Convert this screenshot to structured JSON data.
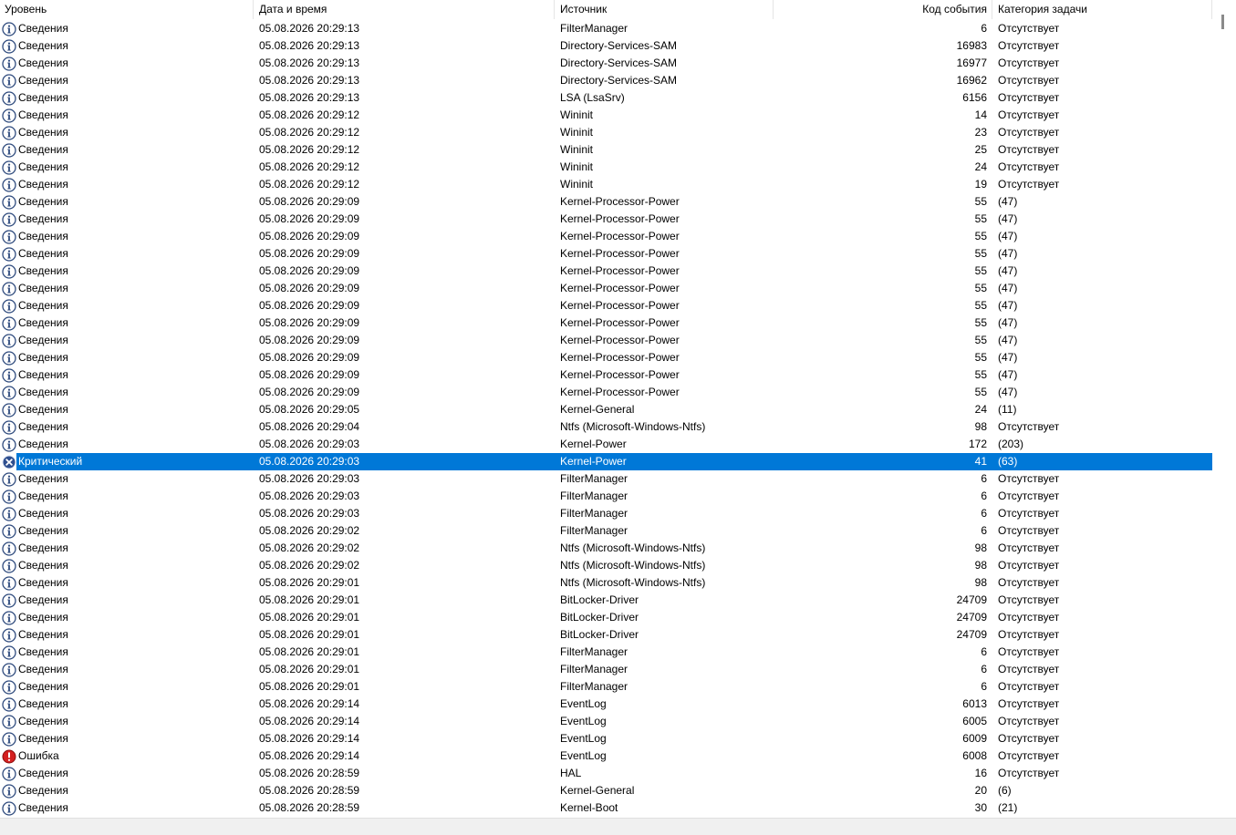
{
  "columns": {
    "level": "Уровень",
    "datetime": "Дата и время",
    "source": "Источник",
    "event_id": "Код события",
    "task_category": "Категория задачи"
  },
  "selected_row": 25,
  "rows": [
    {
      "level": "Сведения",
      "type": "info",
      "datetime": "05.08.2026 20:29:13",
      "source": "FilterManager",
      "event_id": "6",
      "category": "Отсутствует"
    },
    {
      "level": "Сведения",
      "type": "info",
      "datetime": "05.08.2026 20:29:13",
      "source": "Directory-Services-SAM",
      "event_id": "16983",
      "category": "Отсутствует"
    },
    {
      "level": "Сведения",
      "type": "info",
      "datetime": "05.08.2026 20:29:13",
      "source": "Directory-Services-SAM",
      "event_id": "16977",
      "category": "Отсутствует"
    },
    {
      "level": "Сведения",
      "type": "info",
      "datetime": "05.08.2026 20:29:13",
      "source": "Directory-Services-SAM",
      "event_id": "16962",
      "category": "Отсутствует"
    },
    {
      "level": "Сведения",
      "type": "info",
      "datetime": "05.08.2026 20:29:13",
      "source": "LSA (LsaSrv)",
      "event_id": "6156",
      "category": "Отсутствует"
    },
    {
      "level": "Сведения",
      "type": "info",
      "datetime": "05.08.2026 20:29:12",
      "source": "Wininit",
      "event_id": "14",
      "category": "Отсутствует"
    },
    {
      "level": "Сведения",
      "type": "info",
      "datetime": "05.08.2026 20:29:12",
      "source": "Wininit",
      "event_id": "23",
      "category": "Отсутствует"
    },
    {
      "level": "Сведения",
      "type": "info",
      "datetime": "05.08.2026 20:29:12",
      "source": "Wininit",
      "event_id": "25",
      "category": "Отсутствует"
    },
    {
      "level": "Сведения",
      "type": "info",
      "datetime": "05.08.2026 20:29:12",
      "source": "Wininit",
      "event_id": "24",
      "category": "Отсутствует"
    },
    {
      "level": "Сведения",
      "type": "info",
      "datetime": "05.08.2026 20:29:12",
      "source": "Wininit",
      "event_id": "19",
      "category": "Отсутствует"
    },
    {
      "level": "Сведения",
      "type": "info",
      "datetime": "05.08.2026 20:29:09",
      "source": "Kernel-Processor-Power",
      "event_id": "55",
      "category": "(47)"
    },
    {
      "level": "Сведения",
      "type": "info",
      "datetime": "05.08.2026 20:29:09",
      "source": "Kernel-Processor-Power",
      "event_id": "55",
      "category": "(47)"
    },
    {
      "level": "Сведения",
      "type": "info",
      "datetime": "05.08.2026 20:29:09",
      "source": "Kernel-Processor-Power",
      "event_id": "55",
      "category": "(47)"
    },
    {
      "level": "Сведения",
      "type": "info",
      "datetime": "05.08.2026 20:29:09",
      "source": "Kernel-Processor-Power",
      "event_id": "55",
      "category": "(47)"
    },
    {
      "level": "Сведения",
      "type": "info",
      "datetime": "05.08.2026 20:29:09",
      "source": "Kernel-Processor-Power",
      "event_id": "55",
      "category": "(47)"
    },
    {
      "level": "Сведения",
      "type": "info",
      "datetime": "05.08.2026 20:29:09",
      "source": "Kernel-Processor-Power",
      "event_id": "55",
      "category": "(47)"
    },
    {
      "level": "Сведения",
      "type": "info",
      "datetime": "05.08.2026 20:29:09",
      "source": "Kernel-Processor-Power",
      "event_id": "55",
      "category": "(47)"
    },
    {
      "level": "Сведения",
      "type": "info",
      "datetime": "05.08.2026 20:29:09",
      "source": "Kernel-Processor-Power",
      "event_id": "55",
      "category": "(47)"
    },
    {
      "level": "Сведения",
      "type": "info",
      "datetime": "05.08.2026 20:29:09",
      "source": "Kernel-Processor-Power",
      "event_id": "55",
      "category": "(47)"
    },
    {
      "level": "Сведения",
      "type": "info",
      "datetime": "05.08.2026 20:29:09",
      "source": "Kernel-Processor-Power",
      "event_id": "55",
      "category": "(47)"
    },
    {
      "level": "Сведения",
      "type": "info",
      "datetime": "05.08.2026 20:29:09",
      "source": "Kernel-Processor-Power",
      "event_id": "55",
      "category": "(47)"
    },
    {
      "level": "Сведения",
      "type": "info",
      "datetime": "05.08.2026 20:29:09",
      "source": "Kernel-Processor-Power",
      "event_id": "55",
      "category": "(47)"
    },
    {
      "level": "Сведения",
      "type": "info",
      "datetime": "05.08.2026 20:29:05",
      "source": "Kernel-General",
      "event_id": "24",
      "category": "(11)"
    },
    {
      "level": "Сведения",
      "type": "info",
      "datetime": "05.08.2026 20:29:04",
      "source": "Ntfs (Microsoft-Windows-Ntfs)",
      "event_id": "98",
      "category": "Отсутствует"
    },
    {
      "level": "Сведения",
      "type": "info",
      "datetime": "05.08.2026 20:29:03",
      "source": "Kernel-Power",
      "event_id": "172",
      "category": "(203)"
    },
    {
      "level": "Критический",
      "type": "critical",
      "datetime": "05.08.2026 20:29:03",
      "source": "Kernel-Power",
      "event_id": "41",
      "category": "(63)"
    },
    {
      "level": "Сведения",
      "type": "info",
      "datetime": "05.08.2026 20:29:03",
      "source": "FilterManager",
      "event_id": "6",
      "category": "Отсутствует"
    },
    {
      "level": "Сведения",
      "type": "info",
      "datetime": "05.08.2026 20:29:03",
      "source": "FilterManager",
      "event_id": "6",
      "category": "Отсутствует"
    },
    {
      "level": "Сведения",
      "type": "info",
      "datetime": "05.08.2026 20:29:03",
      "source": "FilterManager",
      "event_id": "6",
      "category": "Отсутствует"
    },
    {
      "level": "Сведения",
      "type": "info",
      "datetime": "05.08.2026 20:29:02",
      "source": "FilterManager",
      "event_id": "6",
      "category": "Отсутствует"
    },
    {
      "level": "Сведения",
      "type": "info",
      "datetime": "05.08.2026 20:29:02",
      "source": "Ntfs (Microsoft-Windows-Ntfs)",
      "event_id": "98",
      "category": "Отсутствует"
    },
    {
      "level": "Сведения",
      "type": "info",
      "datetime": "05.08.2026 20:29:02",
      "source": "Ntfs (Microsoft-Windows-Ntfs)",
      "event_id": "98",
      "category": "Отсутствует"
    },
    {
      "level": "Сведения",
      "type": "info",
      "datetime": "05.08.2026 20:29:01",
      "source": "Ntfs (Microsoft-Windows-Ntfs)",
      "event_id": "98",
      "category": "Отсутствует"
    },
    {
      "level": "Сведения",
      "type": "info",
      "datetime": "05.08.2026 20:29:01",
      "source": "BitLocker-Driver",
      "event_id": "24709",
      "category": "Отсутствует"
    },
    {
      "level": "Сведения",
      "type": "info",
      "datetime": "05.08.2026 20:29:01",
      "source": "BitLocker-Driver",
      "event_id": "24709",
      "category": "Отсутствует"
    },
    {
      "level": "Сведения",
      "type": "info",
      "datetime": "05.08.2026 20:29:01",
      "source": "BitLocker-Driver",
      "event_id": "24709",
      "category": "Отсутствует"
    },
    {
      "level": "Сведения",
      "type": "info",
      "datetime": "05.08.2026 20:29:01",
      "source": "FilterManager",
      "event_id": "6",
      "category": "Отсутствует"
    },
    {
      "level": "Сведения",
      "type": "info",
      "datetime": "05.08.2026 20:29:01",
      "source": "FilterManager",
      "event_id": "6",
      "category": "Отсутствует"
    },
    {
      "level": "Сведения",
      "type": "info",
      "datetime": "05.08.2026 20:29:01",
      "source": "FilterManager",
      "event_id": "6",
      "category": "Отсутствует"
    },
    {
      "level": "Сведения",
      "type": "info",
      "datetime": "05.08.2026 20:29:14",
      "source": "EventLog",
      "event_id": "6013",
      "category": "Отсутствует"
    },
    {
      "level": "Сведения",
      "type": "info",
      "datetime": "05.08.2026 20:29:14",
      "source": "EventLog",
      "event_id": "6005",
      "category": "Отсутствует"
    },
    {
      "level": "Сведения",
      "type": "info",
      "datetime": "05.08.2026 20:29:14",
      "source": "EventLog",
      "event_id": "6009",
      "category": "Отсутствует"
    },
    {
      "level": "Ошибка",
      "type": "error",
      "datetime": "05.08.2026 20:29:14",
      "source": "EventLog",
      "event_id": "6008",
      "category": "Отсутствует"
    },
    {
      "level": "Сведения",
      "type": "info",
      "datetime": "05.08.2026 20:28:59",
      "source": "HAL",
      "event_id": "16",
      "category": "Отсутствует"
    },
    {
      "level": "Сведения",
      "type": "info",
      "datetime": "05.08.2026 20:28:59",
      "source": "Kernel-General",
      "event_id": "20",
      "category": "(6)"
    },
    {
      "level": "Сведения",
      "type": "info",
      "datetime": "05.08.2026 20:28:59",
      "source": "Kernel-Boot",
      "event_id": "30",
      "category": "(21)"
    }
  ]
}
